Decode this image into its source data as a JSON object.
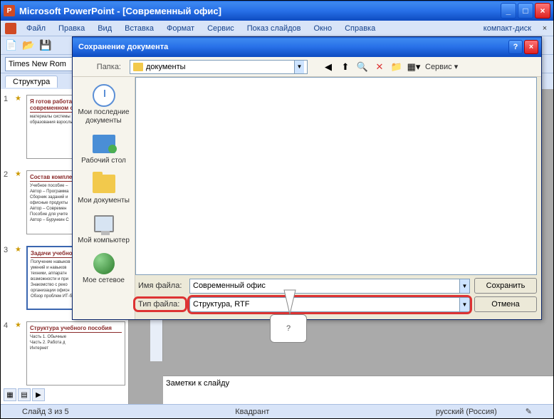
{
  "app": {
    "title": "Microsoft PowerPoint - [Современный офис]"
  },
  "menu": {
    "items": [
      "Файл",
      "Правка",
      "Вид",
      "Вставка",
      "Формат",
      "Сервис",
      "Показ слайдов",
      "Окно",
      "Справка"
    ],
    "right": "компакт-диск"
  },
  "fontbar": {
    "font": "Times New Rom"
  },
  "tabbar": {
    "tab": "Структура"
  },
  "slides": [
    {
      "num": "1",
      "title": "Я готов работать в современном офисе",
      "lines": [
        "материалы системы",
        "образования взрослых"
      ]
    },
    {
      "num": "2",
      "title": "Состав комплекта",
      "lines": [
        "Учебное пособие –",
        "Автор – Программа",
        "Сборник заданий и",
        "офисные продукты",
        "Автор – Современ",
        "Пособие для учите",
        "Автор – Бурункин С"
      ]
    },
    {
      "num": "3",
      "title": "Задачи учебного пособия",
      "lines": [
        "Получение навыков",
        "умений и навыков",
        "техники, аппаратн",
        "возможности и при",
        "Знакомство с реко",
        "организации офисн",
        "Обзор проблем ИТ-безопасности"
      ]
    },
    {
      "num": "4",
      "title": "Структура учебного пособия",
      "lines": [
        "Часть 1. Обычные",
        "Часть 2. Работа д",
        "Интернет"
      ]
    }
  ],
  "notes": {
    "placeholder": "Заметки к слайду"
  },
  "status": {
    "slide": "Слайд 3 из 5",
    "layout": "Квадрант",
    "lang": "русский (Россия)"
  },
  "dialog": {
    "title": "Сохранение документа",
    "folder_label": "Папка:",
    "folder_value": "документы",
    "service": "Сервис",
    "places": [
      {
        "key": "recent",
        "label": "Мои последние документы"
      },
      {
        "key": "desktop",
        "label": "Рабочий стол"
      },
      {
        "key": "mydocs",
        "label": "Мои документы"
      },
      {
        "key": "mycomp",
        "label": "Мой компьютер"
      },
      {
        "key": "network",
        "label": "Мое сетевое"
      }
    ],
    "filename_label": "Имя файла:",
    "filename_value": "Современный офис",
    "filetype_label": "Тип файла:",
    "filetype_value": "Структура, RTF",
    "save": "Сохранить",
    "cancel": "Отмена"
  },
  "callout": {
    "text": "?"
  }
}
